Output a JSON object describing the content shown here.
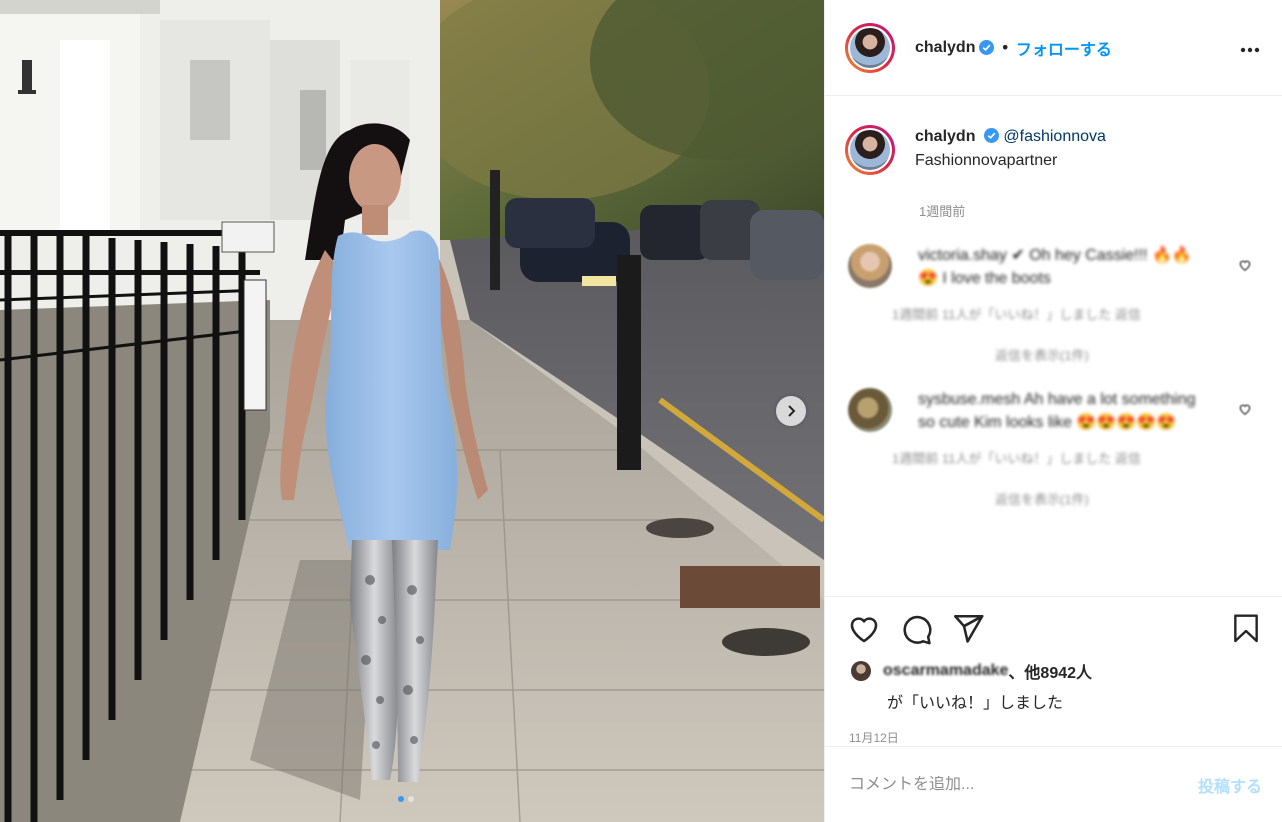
{
  "post": {
    "username": "chalydn",
    "separator": "•",
    "follow_label": "フォローする",
    "caption": {
      "username": "chalydn",
      "mention": "@fashionnova",
      "text": "Fashionnovapartner",
      "time": "1週間前"
    },
    "comments": [
      {
        "text": "victoria.shay ✔ Oh hey Cassie!!! 🔥🔥 😍 I love the boots",
        "meta": "1週間前   11人が「いいね！」しました   返信",
        "replies": "返信を表示(1件)"
      },
      {
        "text": "sysbuse.mesh Ah have a lot something so cute Kim looks like 😍😍😍😍😍",
        "meta": "1週間前   11人が「いいね！」しました   返信",
        "replies": "返信を表示(1件)"
      }
    ],
    "likes": {
      "first_liker": "oscarmamadake",
      "others": "、他8942人",
      "suffix": "が「いいね！」しました"
    },
    "date": "11月12日",
    "add_comment_placeholder": "コメントを追加...",
    "post_button": "投稿する"
  },
  "icons": {
    "verified": "verified-badge-icon",
    "more": "more-options-icon",
    "like": "heart-icon",
    "comment": "comment-icon",
    "share": "share-icon",
    "save": "bookmark-icon",
    "next": "chevron-right-icon"
  },
  "colors": {
    "accent": "#0095f6",
    "post_disabled": "#b2dffc",
    "muted": "#8e8e8e",
    "dress": "#9dbfe6"
  },
  "carousel": {
    "current": 1,
    "total": 2
  }
}
